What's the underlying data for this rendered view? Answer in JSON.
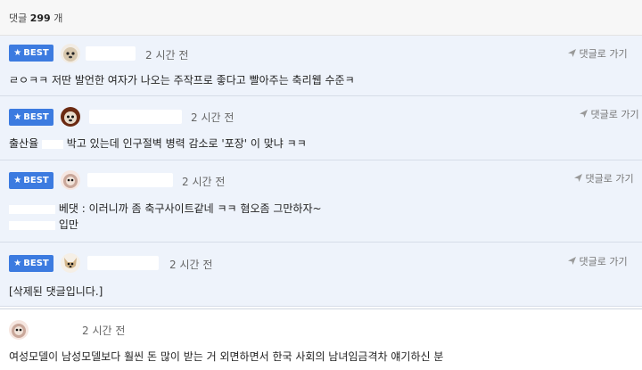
{
  "comment_count": {
    "label": "댓글",
    "count": "299",
    "unit": "개"
  },
  "reply_label": "댓글로 가기",
  "best_label": "BEST",
  "comments": [
    {
      "best": true,
      "time": "2 시간 전",
      "text": "ㄹㅇㅋㅋ 저딴 발언한 여자가 나오는 주작프로 좋다고 빨아주는 축리웹 수준ㅋ"
    },
    {
      "best": true,
      "time": "2 시간 전",
      "text_prefix": "출산율",
      "text_suffix": "박고 있는데 인구절벽 병력 감소로 '포장' 이 맞냐 ㅋㅋ"
    },
    {
      "best": true,
      "time": "2 시간 전",
      "text": "베댓 : 이러니까 좀 축구사이트같네 ㅋㅋ 혐오좀 그만하자~",
      "text_line2": "입만"
    },
    {
      "best": true,
      "time": "2 시간 전",
      "text": "[삭제된 댓글입니다.]"
    },
    {
      "best": false,
      "time": "2 시간 전",
      "text": "여성모델이 남성모델보다 훨씬 돈 많이 받는 거 외면하면서 한국 사회의 남녀임금격차 얘기하신 분"
    }
  ]
}
